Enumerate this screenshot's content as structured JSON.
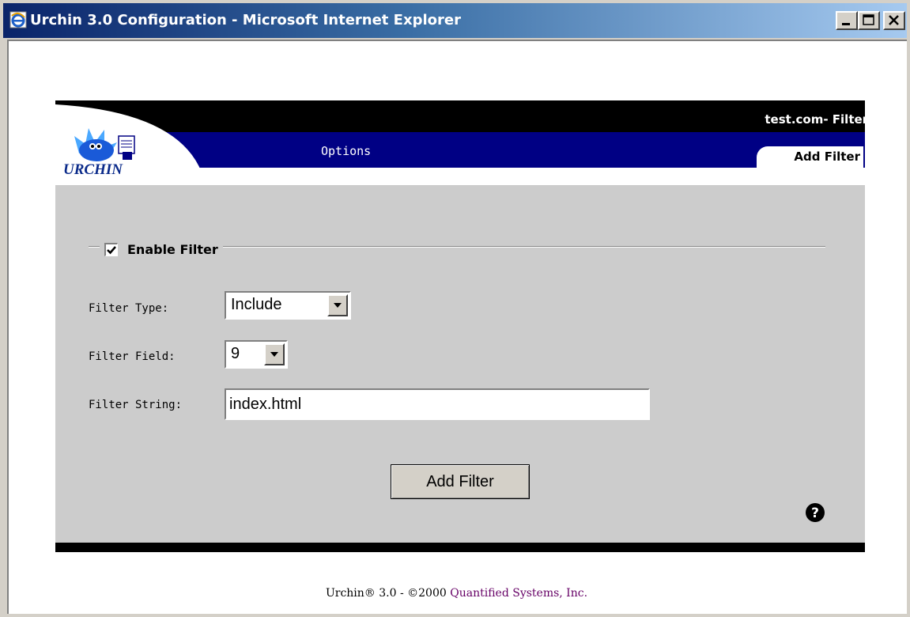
{
  "window": {
    "title": "Urchin 3.0 Configuration - Microsoft Internet Explorer",
    "controls": [
      "minimize-icon",
      "maximize-icon",
      "close-icon"
    ]
  },
  "header": {
    "logo_text": "URCHIN",
    "domain_title": "test.com- Filters",
    "nav_tab": "Options",
    "active_tab": "Add Filter"
  },
  "form": {
    "enable": {
      "label": "Enable Filter",
      "checked": true
    },
    "filter_type": {
      "label": "Filter Type:",
      "value": "Include"
    },
    "filter_field": {
      "label": "Filter Field:",
      "value": "9"
    },
    "filter_string": {
      "label": "Filter String:",
      "value": "index.html"
    },
    "submit_label": "Add Filter",
    "help_icon": "question-circle-icon"
  },
  "footer": {
    "text": "Urchin® 3.0 - ©2000 ",
    "company": "Quantified Systems, Inc."
  },
  "colors": {
    "title_bar_start": "#0a246a",
    "title_bar_end": "#a6caf0",
    "nav_blue": "#000084",
    "panel_gray": "#cccccc",
    "company_link": "#660066"
  }
}
